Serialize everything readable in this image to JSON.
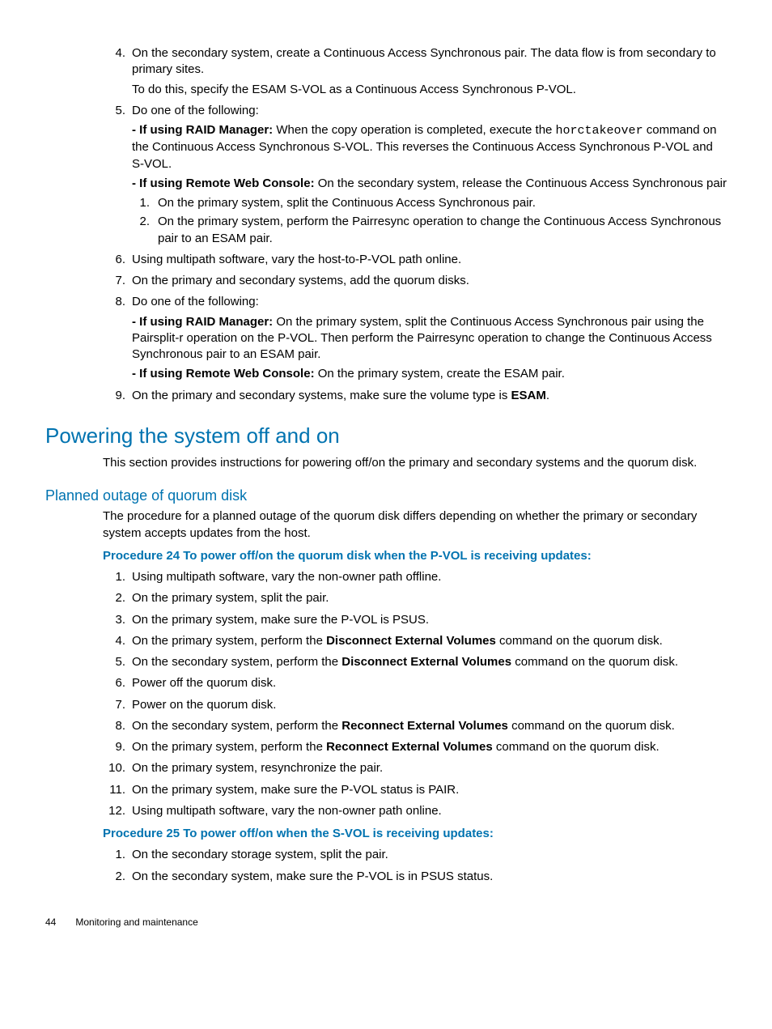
{
  "top_list": {
    "i4": {
      "num": "4.",
      "p1_a": "On the secondary system, create a Continuous Access Synchronous pair. The data flow is from secondary to primary sites.",
      "p2": "To do this, specify the ESAM S-VOL as a Continuous Access Synchronous P-VOL."
    },
    "i5": {
      "num": "5.",
      "lead": "Do one of the following:",
      "raid_lead": "- If using RAID Manager:",
      "raid_a": " When the copy operation is completed, execute the ",
      "raid_code": "horctakeover",
      "raid_b": " command on the Continuous Access Synchronous S-VOL. This reverses the Continuous Access Synchronous P-VOL and S-VOL.",
      "rwc_lead": "- If using Remote Web Console:",
      "rwc_a": " On the secondary system, release the Continuous Access Synchronous pair",
      "n1_num": "1.",
      "n1": "On the primary system, split the Continuous Access Synchronous pair.",
      "n2_num": "2.",
      "n2": "On the primary system, perform the Pairresync operation to change the Continuous Access Synchronous pair to an ESAM pair."
    },
    "i6": {
      "num": "6.",
      "t": "Using multipath software, vary the host-to-P-VOL path online."
    },
    "i7": {
      "num": "7.",
      "t": "On the primary and secondary systems, add the quorum disks."
    },
    "i8": {
      "num": "8.",
      "lead": "Do one of the following:",
      "raid_lead": "- If using RAID Manager:",
      "raid_t": " On the primary system, split the Continuous Access Synchronous pair using the Pairsplit-r operation on the P-VOL. Then perform the Pairresync operation to change the Continuous Access Synchronous pair to an ESAM pair.",
      "rwc_lead": "- If using Remote Web Console:",
      "rwc_t": " On the primary system, create the ESAM pair."
    },
    "i9": {
      "num": "9.",
      "a": "On the primary and secondary systems, make sure the volume type is ",
      "b": "ESAM",
      "c": "."
    }
  },
  "h2": "Powering the system off and on",
  "h2_body": "This section provides instructions for powering off/on the primary and secondary systems and the quorum disk.",
  "h3": "Planned outage of quorum disk",
  "h3_body": "The procedure for a planned outage of the quorum disk differs depending on whether the primary or secondary system accepts updates from the host.",
  "proc24": "Procedure 24 To power off/on the quorum disk when the P-VOL is receiving updates:",
  "p24": {
    "i1": {
      "num": "1.",
      "t": "Using multipath software, vary the non-owner path offline."
    },
    "i2": {
      "num": "2.",
      "t": "On the primary system, split the pair."
    },
    "i3": {
      "num": "3.",
      "t": "On the primary system, make sure the P-VOL is PSUS."
    },
    "i4": {
      "num": "4.",
      "a": "On the primary system, perform the ",
      "b": "Disconnect External Volumes",
      "c": " command on the quorum disk."
    },
    "i5": {
      "num": "5.",
      "a": "On the secondary system, perform the ",
      "b": "Disconnect External Volumes",
      "c": " command on the quorum disk."
    },
    "i6": {
      "num": "6.",
      "t": "Power off the quorum disk."
    },
    "i7": {
      "num": "7.",
      "t": "Power on the quorum disk."
    },
    "i8": {
      "num": "8.",
      "a": "On the secondary system, perform the ",
      "b": "Reconnect External Volumes",
      "c": " command on the quorum disk."
    },
    "i9": {
      "num": "9.",
      "a": "On the primary system, perform the ",
      "b": "Reconnect External Volumes",
      "c": " command on the quorum disk."
    },
    "i10": {
      "num": "10.",
      "t": "On the primary system, resynchronize the pair."
    },
    "i11": {
      "num": "11.",
      "t": "On the primary system, make sure the P-VOL status is PAIR."
    },
    "i12": {
      "num": "12.",
      "t": "Using multipath software, vary the non-owner path online."
    }
  },
  "proc25": "Procedure 25 To power off/on when the S-VOL is receiving updates:",
  "p25": {
    "i1": {
      "num": "1.",
      "t": "On the secondary storage system, split the pair."
    },
    "i2": {
      "num": "2.",
      "t": "On the secondary system, make sure the P-VOL is in PSUS status."
    }
  },
  "footer": {
    "page": "44",
    "title": "Monitoring and maintenance"
  }
}
